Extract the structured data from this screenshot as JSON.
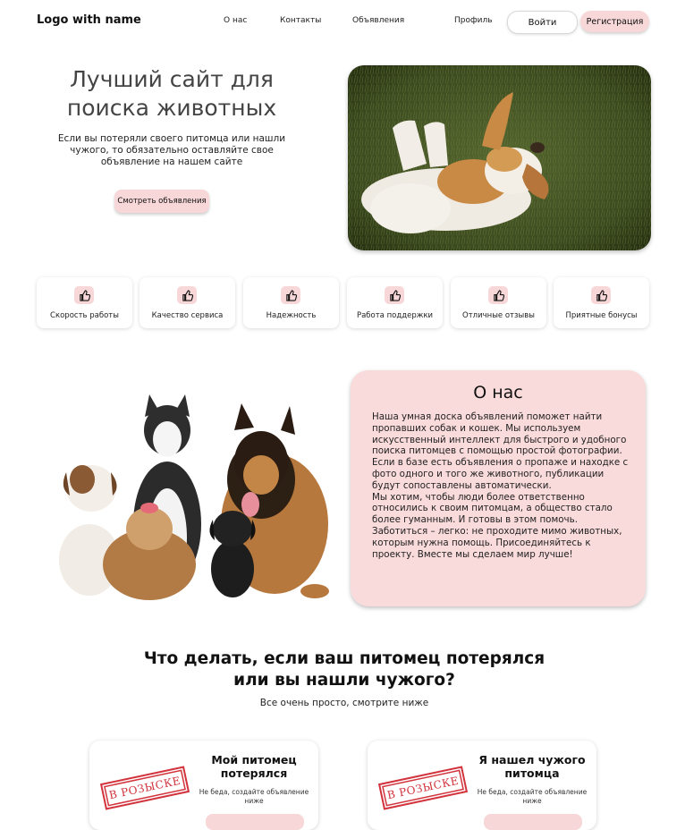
{
  "header": {
    "logo": "Logo with name",
    "nav": [
      "О нас",
      "Контакты",
      "Объявления",
      "Профиль"
    ],
    "login": "Войти",
    "register": "Регистрация"
  },
  "hero": {
    "title": "Лучший сайт для поиска животных",
    "subtitle": "Если вы потеряли своего питомца или нашли чужого, то обязательно оставляйте свое объявление на нашем сайте",
    "button": "Смотреть объявления",
    "image": "dog-lying-on-grass"
  },
  "features": [
    {
      "icon": "thumbs-up-icon",
      "label": "Скорость работы"
    },
    {
      "icon": "thumbs-up-icon",
      "label": "Качество сервиса"
    },
    {
      "icon": "thumbs-up-icon",
      "label": "Надежность"
    },
    {
      "icon": "thumbs-up-icon",
      "label": "Работа поддержки"
    },
    {
      "icon": "thumbs-up-icon",
      "label": "Отличные отзывы"
    },
    {
      "icon": "thumbs-up-icon",
      "label": "Приятные бонусы"
    }
  ],
  "about": {
    "image": "group-of-dogs",
    "title": "О нас",
    "paragraph1": "Наша умная доска объявлений поможет найти пропавших собак и кошек. Мы используем искусственный интеллект для быстрого и удобного поиска питомцев с помощью простой фотографии. Если в базе есть объявления о пропаже и находке с фото одного и того же животного, публикации будут сопоставлены автоматически.",
    "paragraph2": "Мы хотим, чтобы люди более ответственно относились к своим питомцам, а общество стало более гуманным. И готовы в этом помочь. Заботиться – легко: не проходите мимо животных, которым нужна помощь. Присоединяйтесь к проекту. Вместе мы сделаем мир лучше!"
  },
  "how": {
    "title": "Что делать, если ваш питомец потерялся или вы нашли чужого?",
    "subtitle": "Все очень просто, смотрите ниже",
    "cards": [
      {
        "stamp": "В РОЗЫСКЕ",
        "title": "Мой питомец потерялся",
        "text": "Не беда, создайте объявление ниже"
      },
      {
        "stamp": "В РОЗЫСКЕ",
        "title": "Я нашел чужого питомца",
        "text": "Не беда, создайте объявление ниже"
      }
    ]
  }
}
